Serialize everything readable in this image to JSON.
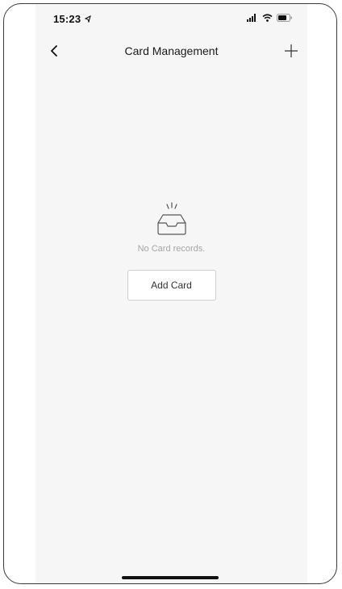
{
  "status_bar": {
    "time": "15:23",
    "icons": [
      "location-arrow-icon",
      "signal-icon",
      "wifi-icon",
      "battery-icon"
    ]
  },
  "nav": {
    "title": "Card Management",
    "back_icon": "chevron-left-icon",
    "add_icon": "plus-icon"
  },
  "empty_state": {
    "icon": "empty-inbox-icon",
    "message": "No Card records.",
    "button_label": "Add Card"
  },
  "colors": {
    "background": "#f6f6f6",
    "text_primary": "#1a1a1a",
    "text_muted": "#a5a5a5",
    "button_border": "#cfcfcf"
  }
}
